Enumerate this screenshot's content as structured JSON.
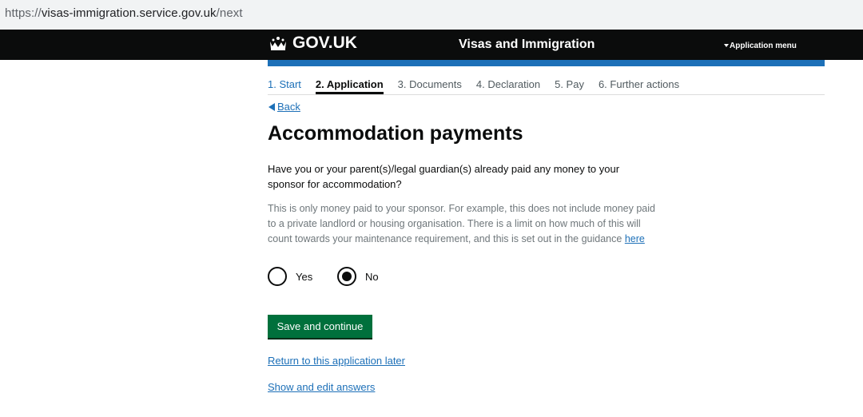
{
  "browser": {
    "url_scheme": "https://",
    "url_host": "visas-immigration.service.gov.uk",
    "url_path": "/next"
  },
  "header": {
    "logo_text": "GOV.UK",
    "service_name": "Visas and Immigration",
    "menu_label": "Application menu"
  },
  "steps": [
    {
      "label": "1. Start"
    },
    {
      "label": "2. Application"
    },
    {
      "label": "3. Documents"
    },
    {
      "label": "4. Declaration"
    },
    {
      "label": "5. Pay"
    },
    {
      "label": "6. Further actions"
    }
  ],
  "back_label": "Back",
  "page": {
    "title": "Accommodation payments",
    "question": "Have you or your parent(s)/legal guardian(s) already paid any money to your sponsor for accommodation?",
    "hint": "This is only money paid to your sponsor. For example, this does not include money paid to a private landlord or housing organisation. There is a limit on how much of this will count towards your maintenance requirement, and this is set out in the guidance",
    "hint_link": "here"
  },
  "radios": {
    "yes_label": "Yes",
    "no_label": "No",
    "selected": "No"
  },
  "actions": {
    "save_label": "Save and continue",
    "return_label": "Return to this application later",
    "show_label": "Show and edit answers"
  },
  "colors": {
    "header_bg": "#0b0c0c",
    "accent_blue": "#1d70b8",
    "button_green": "#00703c"
  }
}
